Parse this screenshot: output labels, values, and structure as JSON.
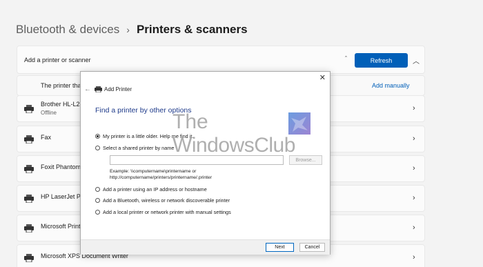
{
  "breadcrumb": {
    "parent": "Bluetooth & devices",
    "separator": "›",
    "current": "Printers & scanners"
  },
  "add_section": {
    "label": "Add a printer or scanner",
    "refresh_label": "Refresh",
    "manual_row_text": "The printer that",
    "add_manually_label": "Add manually"
  },
  "printers": [
    {
      "name": "Brother HL-L232",
      "status": "Offline"
    },
    {
      "name": "Fax"
    },
    {
      "name": "Foxit PhantomP"
    },
    {
      "name": "HP LaserJet Pro"
    },
    {
      "name": "Microsoft Print"
    },
    {
      "name": "Microsoft XPS Document Writer"
    }
  ],
  "dialog": {
    "title": "Add Printer",
    "heading": "Find a printer by other options",
    "options": [
      {
        "label": "My printer is a little older. Help me find it.",
        "selected": true
      },
      {
        "label": "Select a shared printer by name",
        "selected": false
      },
      {
        "label": "Add a printer using an IP address or hostname",
        "selected": false
      },
      {
        "label": "Add a Bluetooth, wireless or network discoverable printer",
        "selected": false
      },
      {
        "label": "Add a local printer or network printer with manual settings",
        "selected": false
      }
    ],
    "shared_input_value": "",
    "browse_label": "Browse...",
    "example_line1": "Example: \\\\computername\\printername or",
    "example_line2": "http://computername/printers/printername/.printer",
    "next_label": "Next",
    "cancel_label": "Cancel"
  },
  "watermark": {
    "line1": "The",
    "line2": "WindowsClub"
  },
  "colors": {
    "accent": "#005fb8",
    "heading": "#1e3a8a",
    "background": "#f3f3f3"
  }
}
